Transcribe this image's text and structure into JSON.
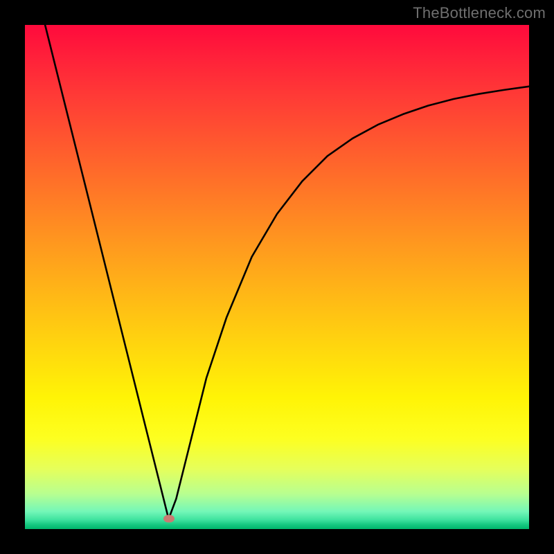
{
  "watermark": "TheBottleneck.com",
  "colors": {
    "frame": "#000000",
    "curve": "#000000",
    "marker": "#c97b72",
    "gradient_top": "#ff0a3c",
    "gradient_bottom": "#00b56b"
  },
  "chart_data": {
    "type": "line",
    "title": "",
    "xlabel": "",
    "ylabel": "",
    "xlim": [
      0,
      100
    ],
    "ylim": [
      0,
      100
    ],
    "grid": false,
    "legend": false,
    "annotations": [
      {
        "type": "marker",
        "x": 28.5,
        "y": 2.0,
        "label": ""
      }
    ],
    "series": [
      {
        "name": "curve",
        "x": [
          4.0,
          8.0,
          12.0,
          16.0,
          20.0,
          24.0,
          27.0,
          28.5,
          30.0,
          32.0,
          36.0,
          40.0,
          45.0,
          50.0,
          55.0,
          60.0,
          65.0,
          70.0,
          75.0,
          80.0,
          85.0,
          90.0,
          95.0,
          100.0
        ],
        "y": [
          100.0,
          84.0,
          68.0,
          52.0,
          36.0,
          20.0,
          8.0,
          2.0,
          6.0,
          14.0,
          30.0,
          42.0,
          54.0,
          62.5,
          69.0,
          74.0,
          77.5,
          80.2,
          82.3,
          84.0,
          85.3,
          86.3,
          87.1,
          87.8
        ]
      }
    ]
  }
}
